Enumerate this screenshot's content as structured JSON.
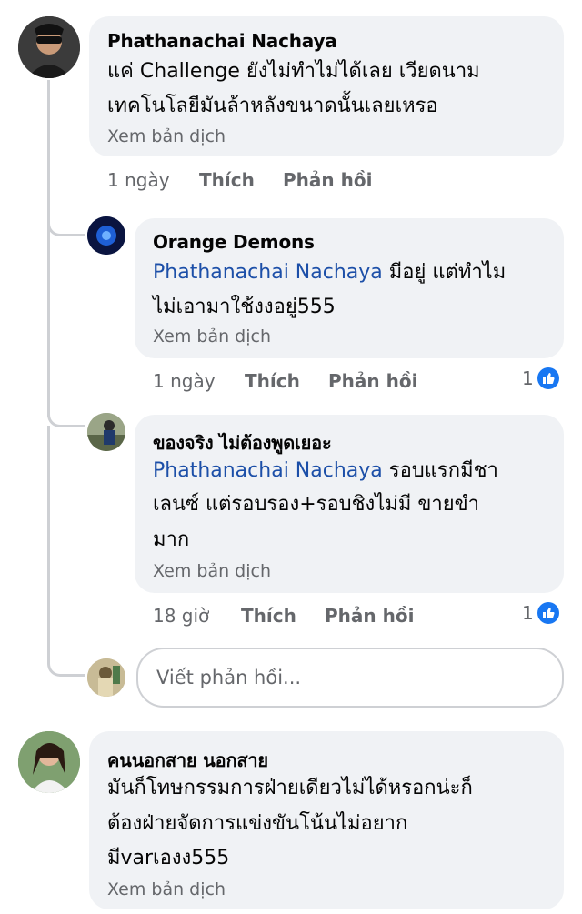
{
  "comments": [
    {
      "author": "Phathanachai Nachaya",
      "lines": [
        "แค่ Challenge ยังไม่ทำไม่ได้เลย  เวียดนาม",
        "เทคโนโลยีมันล้าหลังขนาดนั้นเลยเหรอ"
      ],
      "translate": "Xem bản dịch",
      "time": "1 ngày",
      "like": "Thích",
      "reply": "Phản hồi"
    },
    {
      "author": "Orange Demons",
      "mention": "Phathanachai Nachaya",
      "line1_rest": " มีอยู่ แต่ทำไม",
      "line2": "ไม่เอามาใช้งงอยู่555",
      "translate": "Xem bản dịch",
      "time": "1 ngày",
      "like": "Thích",
      "reply": "Phản hồi",
      "reactions": "1"
    },
    {
      "author": "ของจริง ไม่ต้องพูดเยอะ",
      "mention": "Phathanachai Nachaya",
      "line1_rest": " รอบแรกมีชา",
      "line2": "เลนซ์ แต่รอบรอง+รอบชิงไม่มี ขายขำ",
      "line3": "มาก",
      "translate": "Xem bản dịch",
      "time": "18 giờ",
      "like": "Thích",
      "reply": "Phản hồi",
      "reactions": "1"
    },
    {
      "author": "คนนอกสาย นอกสาย",
      "lines": [
        "มันก็โทษกรรมการฝ่ายเดียวไม่ได้หรอกน่ะก็",
        "ต้องฝ่ายจัดการแข่งขันโน้นไม่อยาก",
        "มีvarเองง555"
      ],
      "translate": "Xem bản dịch"
    }
  ],
  "reply_box": {
    "placeholder": "Viết phản hồi..."
  },
  "colors": {
    "like_blue": "#1877f2",
    "mention": "#1c4fa8",
    "bubble": "#f0f2f5"
  }
}
